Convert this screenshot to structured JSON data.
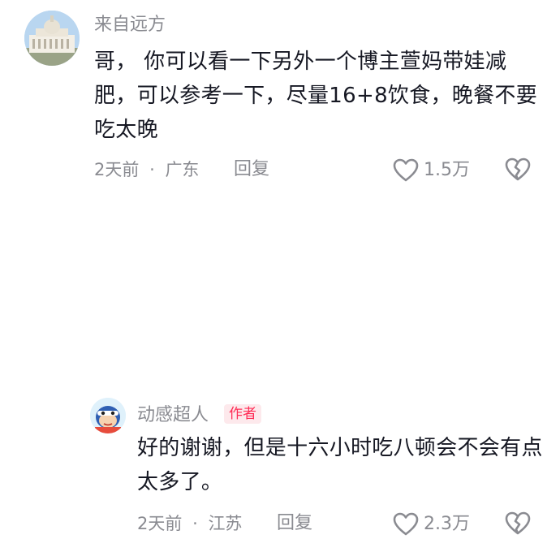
{
  "comments": [
    {
      "username": "来自远方",
      "text": "哥， 你可以看一下另外一个博主萱妈带娃减肥，可以参考一下，尽量16+8饮食，晚餐不要吃太晚",
      "time": "2天前",
      "location": "广东",
      "reply_label": "回复",
      "likes": "1.5万",
      "is_author": false
    },
    {
      "username": "动感超人",
      "badge": "作者",
      "text": "好的谢谢，但是十六小时吃八顿会不会有点太多了。",
      "time": "2天前",
      "location": "江苏",
      "reply_label": "回复",
      "likes": "2.3万",
      "is_author": true
    }
  ],
  "meta_separator": "·",
  "colors": {
    "text": "#161823",
    "muted": "#8a8b91",
    "author_badge_bg": "#fde9ec",
    "author_badge_text": "#fe2c55"
  },
  "icons": {
    "like": "heart-outline-icon",
    "dislike": "broken-heart-icon"
  }
}
